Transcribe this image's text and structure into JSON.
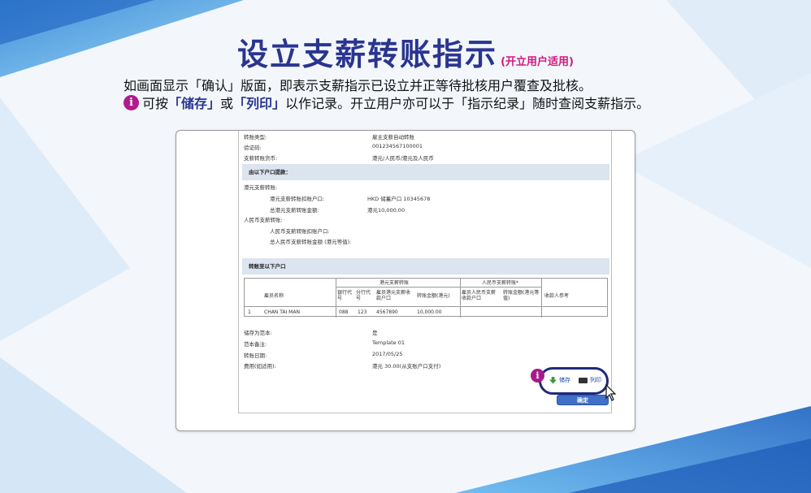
{
  "title": {
    "main": "设立支薪转账指示",
    "sub": "(开立用户适用)"
  },
  "instructions": {
    "line1": "如画面显示「确认」版面，即表示支薪指示已设立并正等待批核用户覆查及批核。",
    "info_icon": "i",
    "line2_prefix": "可按",
    "save_kw": "「储存」",
    "or": "或",
    "print_kw": "「列印」",
    "line2_suffix": "以作记录。开立用户亦可以于「指示纪录」随时查阅支薪指示。"
  },
  "doc": {
    "top_rows": [
      {
        "label": "转账类型:",
        "value": "雇主支薪自动转账"
      },
      {
        "label": "验证码:",
        "value": "001234567100001"
      },
      {
        "label": "支薪转账货币:",
        "value": "港元/人民币/港元及人民币"
      }
    ],
    "section_from": "由以下户口提款：",
    "hkd_header": "港元支薪转账:",
    "hkd_debit_label": "港元支薪转账扣账户口:",
    "hkd_debit_value": "HKD 储蓄户口 10345678",
    "hkd_total_label": "总港元支薪转账金额:",
    "hkd_total_value": "港元10,000.00",
    "rmb_header": "人民币支薪转账:",
    "rmb_debit_label": "人民币支薪转账扣账户口:",
    "rmb_total_label": "总人民币支薪转账金额 (港元等值):",
    "section_to": "转账至以下户口",
    "table": {
      "group_hkd": "港元支薪转账",
      "group_rmb": "人民币支薪转账*",
      "col_name": "雇员名称",
      "col_bank": "银行代号",
      "col_branch": "分行代号",
      "col_acct": "雇员港元支薪收款户口",
      "col_amt": "转账金额(港元)",
      "col_rmb_acct": "雇员人民币支薪收款户口",
      "col_rmb_amt": "转账金额(港元等值)",
      "col_ref": "收款人参考",
      "row": {
        "no": "1",
        "name": "CHAN TAI MAN",
        "bank": "088",
        "branch": "123",
        "acct": "4567890",
        "amt": "10,000.00"
      }
    },
    "bottom_rows": [
      {
        "label": "储存为范本:",
        "value": "是"
      },
      {
        "label": "范本备注:",
        "value": "Template 01"
      },
      {
        "label": "转账日期:",
        "value": "2017/05/25"
      },
      {
        "label": "费用(如适用):",
        "value": "港元 30.00(从支账户口支付)"
      }
    ],
    "badge": "i",
    "save_label": "储存",
    "print_label": "列印",
    "confirm_label": "确定"
  },
  "colors": {
    "title": "#2a3590",
    "accent": "#d4177e",
    "section_bg": "#dbe4ef",
    "highlight": "#1f2b7a"
  }
}
